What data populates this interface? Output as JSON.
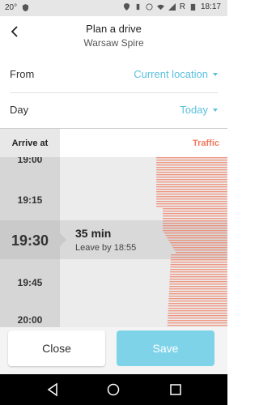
{
  "status": {
    "temp": "20°",
    "battery_badge": "R",
    "time": "18:17"
  },
  "header": {
    "title": "Plan a drive",
    "subtitle": "Warsaw Spire"
  },
  "form": {
    "from_label": "From",
    "from_value": "Current location",
    "day_label": "Day",
    "day_value": "Today"
  },
  "table": {
    "arrive_label": "Arrive at",
    "traffic_label": "Traffic"
  },
  "timeline": {
    "times": [
      "19:00",
      "19:15",
      "19:30",
      "19:45",
      "20:00"
    ],
    "selected": {
      "time": "19:30",
      "duration": "35 min",
      "leave_by": "Leave by 18:55"
    },
    "accent": "#f07a5f"
  },
  "actions": {
    "close_label": "Close",
    "save_label": "Save"
  },
  "colors": {
    "link": "#5bc0de",
    "save_bg": "#7fd3e8",
    "traffic": "#f07a5f"
  }
}
